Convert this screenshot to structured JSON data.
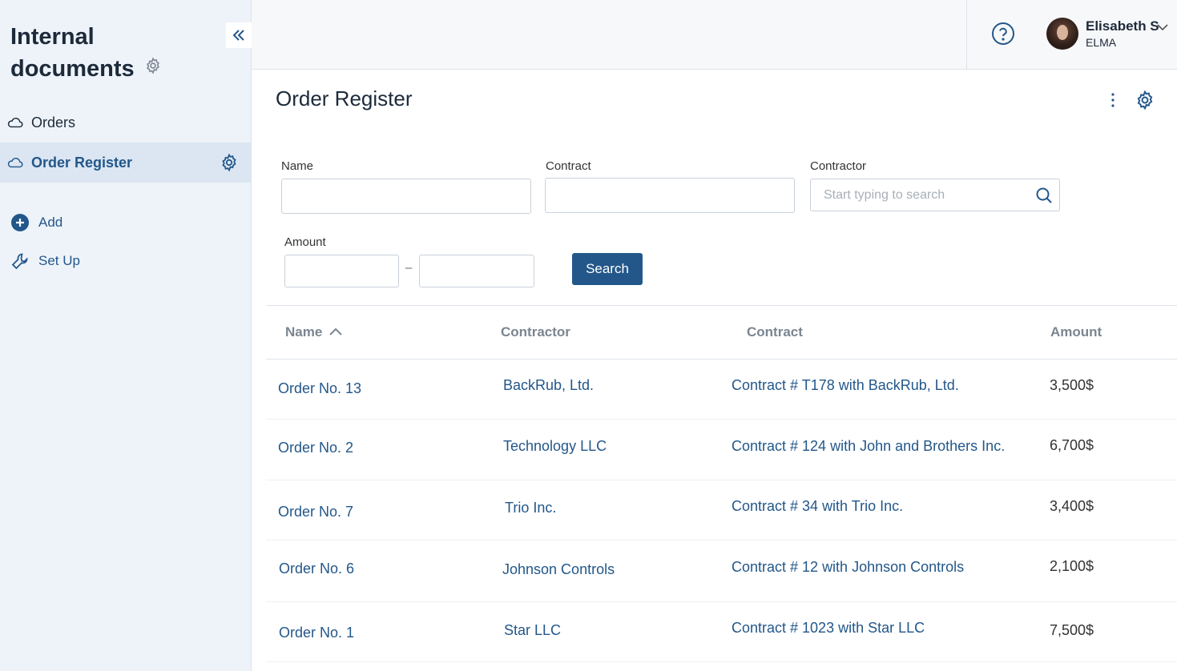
{
  "sidebar": {
    "title_line1": "Internal",
    "title_line2": "documents",
    "items": [
      {
        "label": "Orders",
        "icon": "cloud-icon"
      },
      {
        "label": "Order Register",
        "icon": "cloud-icon",
        "active": true
      }
    ],
    "actions": [
      {
        "label": "Add",
        "icon": "plus-circle-icon"
      },
      {
        "label": "Set Up",
        "icon": "wrench-icon"
      }
    ]
  },
  "header": {
    "user_name": "Elisabeth S",
    "user_org": "ELMA"
  },
  "main": {
    "title": "Order Register",
    "filters": {
      "name_label": "Name",
      "contract_label": "Contract",
      "contractor_label": "Contractor",
      "contractor_placeholder": "Start typing to search",
      "amount_label": "Amount",
      "range_separator": "–",
      "search_button": "Search"
    },
    "columns": [
      "Name",
      "Contractor",
      "Contract",
      "Amount"
    ],
    "rows": [
      {
        "name": "Order No. 13",
        "contractor": "BackRub, Ltd.",
        "contract": "Contract # T178 with BackRub, Ltd.",
        "amount": "3,500$"
      },
      {
        "name": "Order No. 2",
        "contractor": "Technology LLC",
        "contract": "Contract # 124 with John and Brothers Inc.",
        "amount": "6,700$"
      },
      {
        "name": "Order No. 7",
        "contractor": "Trio Inc.",
        "contract": "Contract # 34 with Trio Inc.",
        "amount": "3,400$"
      },
      {
        "name": "Order No. 6",
        "contractor": "Johnson Controls",
        "contract": "Contract # 12 with Johnson Controls",
        "amount": "2,100$"
      },
      {
        "name": "Order No. 1",
        "contractor": "Star LLC",
        "contract": "Contract # 1023 with Star LLC",
        "amount": "7,500$"
      }
    ]
  },
  "colors": {
    "accent": "#23578a",
    "sidebar_bg": "#eef3fa",
    "active_item_bg": "#dbe6f2"
  }
}
